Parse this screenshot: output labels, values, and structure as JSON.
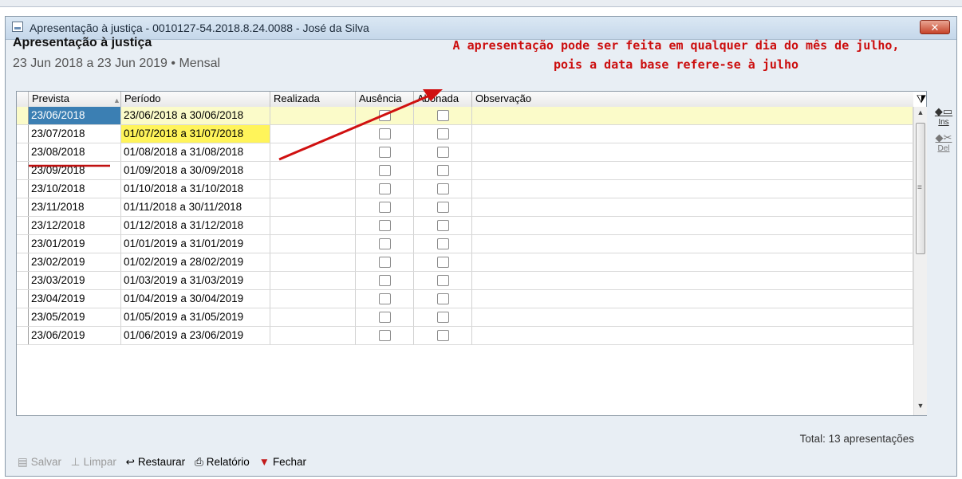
{
  "window": {
    "title": "Apresentação à justiça - 0010127-54.2018.8.24.0088 - José da Silva",
    "close_label": "x",
    "heading": "Apresentação à justiça",
    "subheading": "23 Jun 2018 a 23 Jun 2019 • Mensal"
  },
  "annotation": {
    "line1": "A apresentação pode ser feita em qualquer dia do mês de julho,",
    "line2": "pois a data base refere-se à julho",
    "color": "#cc0d0d"
  },
  "grid": {
    "columns": [
      "Prevista",
      "Período",
      "Realizada",
      "Ausência",
      "Abonada",
      "Observação"
    ],
    "sorted_column": "Prevista",
    "rows": [
      {
        "prevista": "23/06/2018",
        "periodo": "23/06/2018 a 30/06/2018",
        "realizada": "",
        "ausencia": false,
        "abonada": false,
        "observacao": ""
      },
      {
        "prevista": "23/07/2018",
        "periodo": "01/07/2018 a 31/07/2018",
        "realizada": "",
        "ausencia": false,
        "abonada": false,
        "observacao": ""
      },
      {
        "prevista": "23/08/2018",
        "periodo": "01/08/2018 a 31/08/2018",
        "realizada": "",
        "ausencia": false,
        "abonada": false,
        "observacao": ""
      },
      {
        "prevista": "23/09/2018",
        "periodo": "01/09/2018 a 30/09/2018",
        "realizada": "",
        "ausencia": false,
        "abonada": false,
        "observacao": ""
      },
      {
        "prevista": "23/10/2018",
        "periodo": "01/10/2018 a 31/10/2018",
        "realizada": "",
        "ausencia": false,
        "abonada": false,
        "observacao": ""
      },
      {
        "prevista": "23/11/2018",
        "periodo": "01/11/2018 a 30/11/2018",
        "realizada": "",
        "ausencia": false,
        "abonada": false,
        "observacao": ""
      },
      {
        "prevista": "23/12/2018",
        "periodo": "01/12/2018 a 31/12/2018",
        "realizada": "",
        "ausencia": false,
        "abonada": false,
        "observacao": ""
      },
      {
        "prevista": "23/01/2019",
        "periodo": "01/01/2019 a 31/01/2019",
        "realizada": "",
        "ausencia": false,
        "abonada": false,
        "observacao": ""
      },
      {
        "prevista": "23/02/2019",
        "periodo": "01/02/2019 a 28/02/2019",
        "realizada": "",
        "ausencia": false,
        "abonada": false,
        "observacao": ""
      },
      {
        "prevista": "23/03/2019",
        "periodo": "01/03/2019 a 31/03/2019",
        "realizada": "",
        "ausencia": false,
        "abonada": false,
        "observacao": ""
      },
      {
        "prevista": "23/04/2019",
        "periodo": "01/04/2019 a 30/04/2019",
        "realizada": "",
        "ausencia": false,
        "abonada": false,
        "observacao": ""
      },
      {
        "prevista": "23/05/2019",
        "periodo": "01/05/2019 a 31/05/2019",
        "realizada": "",
        "ausencia": false,
        "abonada": false,
        "observacao": ""
      },
      {
        "prevista": "23/06/2019",
        "periodo": "01/06/2019 a 23/06/2019",
        "realizada": "",
        "ausencia": false,
        "abonada": false,
        "observacao": ""
      }
    ]
  },
  "side_tools": {
    "ins_label": "Ins",
    "del_label": "Del"
  },
  "total": "Total: 13 apresentações",
  "toolbar": {
    "salvar": "Salvar",
    "limpar": "Limpar",
    "restaurar": "Restaurar",
    "relatorio": "Relatório",
    "fechar": "Fechar"
  },
  "colors": {
    "selected_row": "#fbfbc9",
    "current_cell": "#3b7fb3",
    "highlight_cell": "#fff45a"
  }
}
